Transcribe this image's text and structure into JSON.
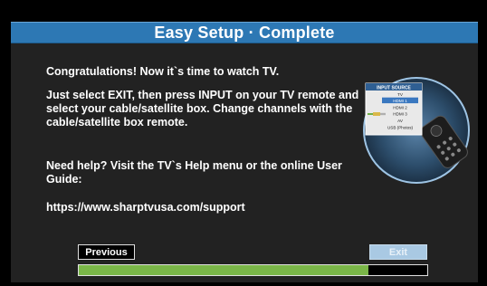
{
  "dialog": {
    "title": "Easy Setup · Complete",
    "line1": "Congratulations! Now it`s time to watch TV.",
    "instructions": "Just select EXIT, then press INPUT on your TV remote and select your cable/satellite box. Change channels with the cable/satellite box remote.",
    "help": "Need help? Visit the TV`s Help menu or the online User Guide:",
    "url": "https://www.sharptvusa.com/support"
  },
  "illustration": {
    "menu_title": "INPUT SOURCE",
    "menu_items": [
      "TV",
      "HDMI 1",
      "HDMI 2",
      "HDMI 3",
      "AV",
      "USB (Photos)"
    ],
    "selected_index": 1,
    "icons": [
      "cable-icon",
      "remote-control-icon"
    ]
  },
  "buttons": {
    "previous_label": "Previous",
    "exit_label": "Exit"
  },
  "progress": {
    "fraction": 0.83
  },
  "colors": {
    "title_bar": "#2d78b4",
    "progress_fill": "#7ab648",
    "exit_button": "#a9c9e3"
  }
}
